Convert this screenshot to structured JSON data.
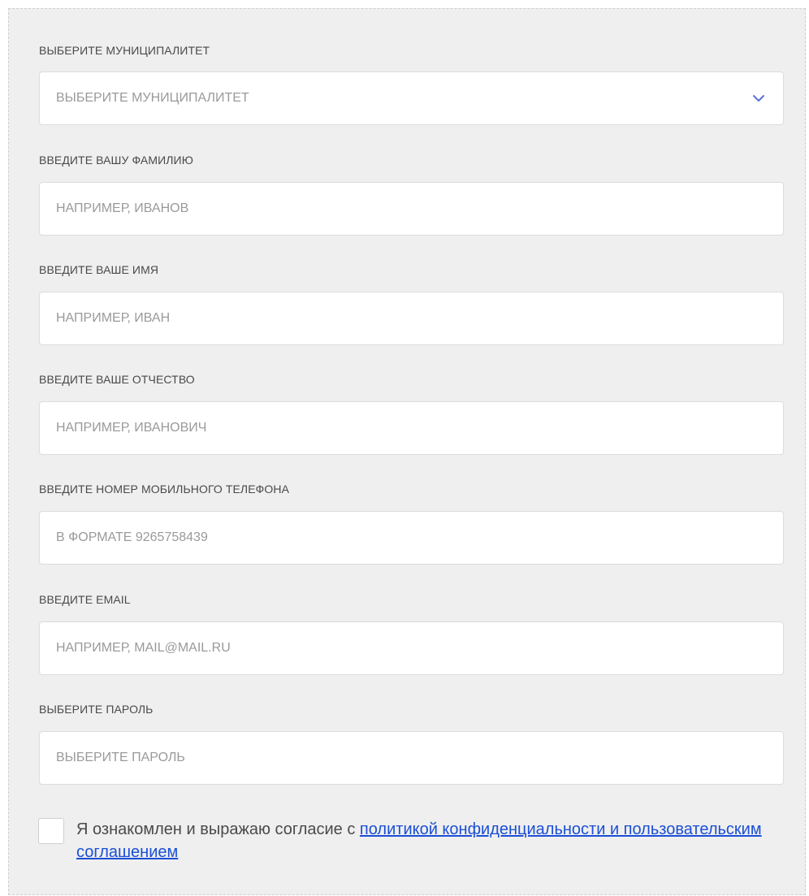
{
  "form": {
    "municipality": {
      "label": "ВЫБЕРИТЕ МУНИЦИПАЛИТЕТ",
      "selected": "ВЫБЕРИТЕ МУНИЦИПАЛИТЕТ"
    },
    "last_name": {
      "label": "ВВЕДИТЕ ВАШУ ФАМИЛИЮ",
      "placeholder": "НАПРИМЕР, ИВАНОВ",
      "value": ""
    },
    "first_name": {
      "label": "ВВЕДИТЕ ВАШЕ ИМЯ",
      "placeholder": "НАПРИМЕР, ИВАН",
      "value": ""
    },
    "middle_name": {
      "label": "ВВЕДИТЕ ВАШЕ ОТЧЕСТВО",
      "placeholder": "НАПРИМЕР, ИВАНОВИЧ",
      "value": ""
    },
    "phone": {
      "label": "ВВЕДИТЕ НОМЕР МОБИЛЬНОГО ТЕЛЕФОНА",
      "placeholder": "В ФОРМАТЕ 9265758439",
      "value": ""
    },
    "email": {
      "label": "ВВЕДИТЕ EMAIL",
      "placeholder": "НАПРИМЕР, MAIL@MAIL.RU",
      "value": ""
    },
    "password": {
      "label": "ВЫБЕРИТЕ ПАРОЛЬ",
      "placeholder": "ВЫБЕРИТЕ ПАРОЛЬ",
      "value": ""
    },
    "consent": {
      "checked": false,
      "text": "Я ознакомлен и выражаю согласие с ",
      "link_text": "политикой конфиденциальности и пользовательским соглашением"
    }
  },
  "colors": {
    "panel_background": "#efefef",
    "field_background": "#ffffff",
    "label_text": "#4a4a4a",
    "placeholder_text": "#9a9a9a",
    "chevron": "#5b6fd6",
    "link": "#1a4fd6"
  },
  "icons": {
    "select_chevron": "chevron-down-icon"
  }
}
